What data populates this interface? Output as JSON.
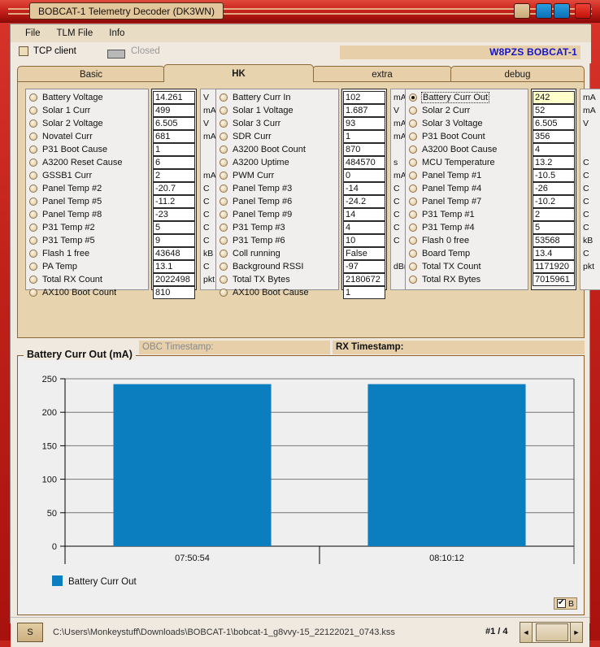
{
  "window": {
    "title": "BOBCAT-1 Telemetry Decoder (DK3WN)",
    "buttons": [
      "minimize",
      "restore",
      "maximize",
      "close"
    ]
  },
  "menu": {
    "items": [
      {
        "label": "File"
      },
      {
        "label": "TLM File"
      },
      {
        "label": "Info"
      }
    ]
  },
  "connection": {
    "tcp_label": "TCP client",
    "tcp_checked": false,
    "status": "Closed",
    "callsign": "W8PZS BOBCAT-1"
  },
  "tabs": [
    {
      "label": "Basic",
      "active": false
    },
    {
      "label": "HK",
      "active": true
    },
    {
      "label": "extra",
      "active": false
    },
    {
      "label": "debug",
      "active": false
    }
  ],
  "telemetry": {
    "columns": [
      {
        "rows": [
          {
            "name": "Battery Voltage",
            "value": "14.261",
            "unit": "V",
            "selected": false
          },
          {
            "name": "Solar 1 Curr",
            "value": "499",
            "unit": "mA",
            "selected": false
          },
          {
            "name": "Solar 2 Voltage",
            "value": "6.505",
            "unit": "V",
            "selected": false
          },
          {
            "name": "Novatel Curr",
            "value": "681",
            "unit": "mA",
            "selected": false
          },
          {
            "name": "P31 Boot Cause",
            "value": "1",
            "unit": "",
            "selected": false
          },
          {
            "name": "A3200 Reset Cause",
            "value": "6",
            "unit": "",
            "selected": false
          },
          {
            "name": "GSSB1 Curr",
            "value": "2",
            "unit": "mA",
            "selected": false
          },
          {
            "name": "Panel Temp #2",
            "value": "-20.7",
            "unit": "C",
            "selected": false
          },
          {
            "name": "Panel Temp #5",
            "value": "-11.2",
            "unit": "C",
            "selected": false
          },
          {
            "name": "Panel Temp #8",
            "value": "-23",
            "unit": "C",
            "selected": false
          },
          {
            "name": "P31 Temp #2",
            "value": "5",
            "unit": "C",
            "selected": false
          },
          {
            "name": "P31 Temp #5",
            "value": "9",
            "unit": "C",
            "selected": false
          },
          {
            "name": "Flash 1 free",
            "value": "43648",
            "unit": "kB",
            "selected": false
          },
          {
            "name": "PA Temp",
            "value": "13.1",
            "unit": "C",
            "selected": false
          },
          {
            "name": "Total RX Count",
            "value": "2022498",
            "unit": "pkt",
            "selected": false
          },
          {
            "name": "AX100 Boot Count",
            "value": "810",
            "unit": "",
            "selected": false
          }
        ]
      },
      {
        "rows": [
          {
            "name": "Battery Curr In",
            "value": "102",
            "unit": "mA",
            "selected": false
          },
          {
            "name": "Solar 1 Voltage",
            "value": "1.687",
            "unit": "V",
            "selected": false
          },
          {
            "name": "Solar 3 Curr",
            "value": "93",
            "unit": "mA",
            "selected": false
          },
          {
            "name": "SDR Curr",
            "value": "1",
            "unit": "mA",
            "selected": false
          },
          {
            "name": "A3200 Boot Count",
            "value": "870",
            "unit": "",
            "selected": false
          },
          {
            "name": "A3200 Uptime",
            "value": "484570",
            "unit": "s",
            "selected": false
          },
          {
            "name": "PWM Curr",
            "value": "0",
            "unit": "mA",
            "selected": false
          },
          {
            "name": "Panel Temp #3",
            "value": "-14",
            "unit": "C",
            "selected": false
          },
          {
            "name": "Panel Temp #6",
            "value": "-24.2",
            "unit": "C",
            "selected": false
          },
          {
            "name": "Panel Temp #9",
            "value": "14",
            "unit": "C",
            "selected": false
          },
          {
            "name": "P31 Temp #3",
            "value": "4",
            "unit": "C",
            "selected": false
          },
          {
            "name": "P31 Temp #6",
            "value": "10",
            "unit": "C",
            "selected": false
          },
          {
            "name": "Coll running",
            "value": "False",
            "unit": "",
            "selected": false
          },
          {
            "name": "Background RSSI",
            "value": "-97",
            "unit": "dBm",
            "selected": false
          },
          {
            "name": "Total TX Bytes",
            "value": "2180672",
            "unit": "",
            "selected": false
          },
          {
            "name": "AX100 Boot Cause",
            "value": "1",
            "unit": "",
            "selected": false
          }
        ]
      },
      {
        "rows": [
          {
            "name": "Battery Curr Out",
            "value": "242",
            "unit": "mA",
            "selected": true
          },
          {
            "name": "Solar 2 Curr",
            "value": "52",
            "unit": "mA",
            "selected": false
          },
          {
            "name": "Solar 3 Voltage",
            "value": "6.505",
            "unit": "V",
            "selected": false
          },
          {
            "name": "P31 Boot Count",
            "value": "356",
            "unit": "",
            "selected": false
          },
          {
            "name": "A3200 Boot Cause",
            "value": "4",
            "unit": "",
            "selected": false
          },
          {
            "name": "MCU Temperature",
            "value": "13.2",
            "unit": "C",
            "selected": false
          },
          {
            "name": "Panel Temp #1",
            "value": "-10.5",
            "unit": "C",
            "selected": false
          },
          {
            "name": "Panel Temp #4",
            "value": "-26",
            "unit": "C",
            "selected": false
          },
          {
            "name": "Panel Temp #7",
            "value": "-10.2",
            "unit": "C",
            "selected": false
          },
          {
            "name": "P31 Temp #1",
            "value": "2",
            "unit": "C",
            "selected": false
          },
          {
            "name": "P31 Temp #4",
            "value": "5",
            "unit": "C",
            "selected": false
          },
          {
            "name": "Flash 0 free",
            "value": "53568",
            "unit": "kB",
            "selected": false
          },
          {
            "name": "Board Temp",
            "value": "13.4",
            "unit": "C",
            "selected": false
          },
          {
            "name": "Total TX Count",
            "value": "1171920",
            "unit": "pkt",
            "selected": false
          },
          {
            "name": "Total RX Bytes",
            "value": "7015961",
            "unit": "",
            "selected": false
          }
        ]
      }
    ]
  },
  "timestamps": {
    "obc_label": "OBC Timestamp:",
    "obc_value": "",
    "rx_label": "RX Timestamp:",
    "rx_value": ""
  },
  "chart_data": {
    "type": "bar",
    "title": "Battery Curr Out (mA)",
    "categories": [
      "07:50:54",
      "08:10:12"
    ],
    "values": [
      242,
      242
    ],
    "series": [
      {
        "name": "Battery Curr Out",
        "values": [
          242,
          242
        ],
        "color": "#0b7ec0"
      }
    ],
    "xlabel": "",
    "ylabel": "",
    "ylim": [
      0,
      250
    ],
    "yticks": [
      0,
      50,
      100,
      150,
      200,
      250
    ],
    "grid": true,
    "legend_position": "bottom-left",
    "legend_entries": [
      "Battery Curr Out"
    ],
    "plot_background": "#efefef",
    "checkbox_label": "B",
    "checkbox_checked": true
  },
  "statusbar": {
    "s_button": "S",
    "file_path": "C:\\Users\\Monkeystuff\\Downloads\\BOBCAT-1\\bobcat-1_g8vvy-15_22122021_0743.kss",
    "page_count": "#1 / 4",
    "scroll_left": "◄",
    "scroll_right": "►"
  }
}
